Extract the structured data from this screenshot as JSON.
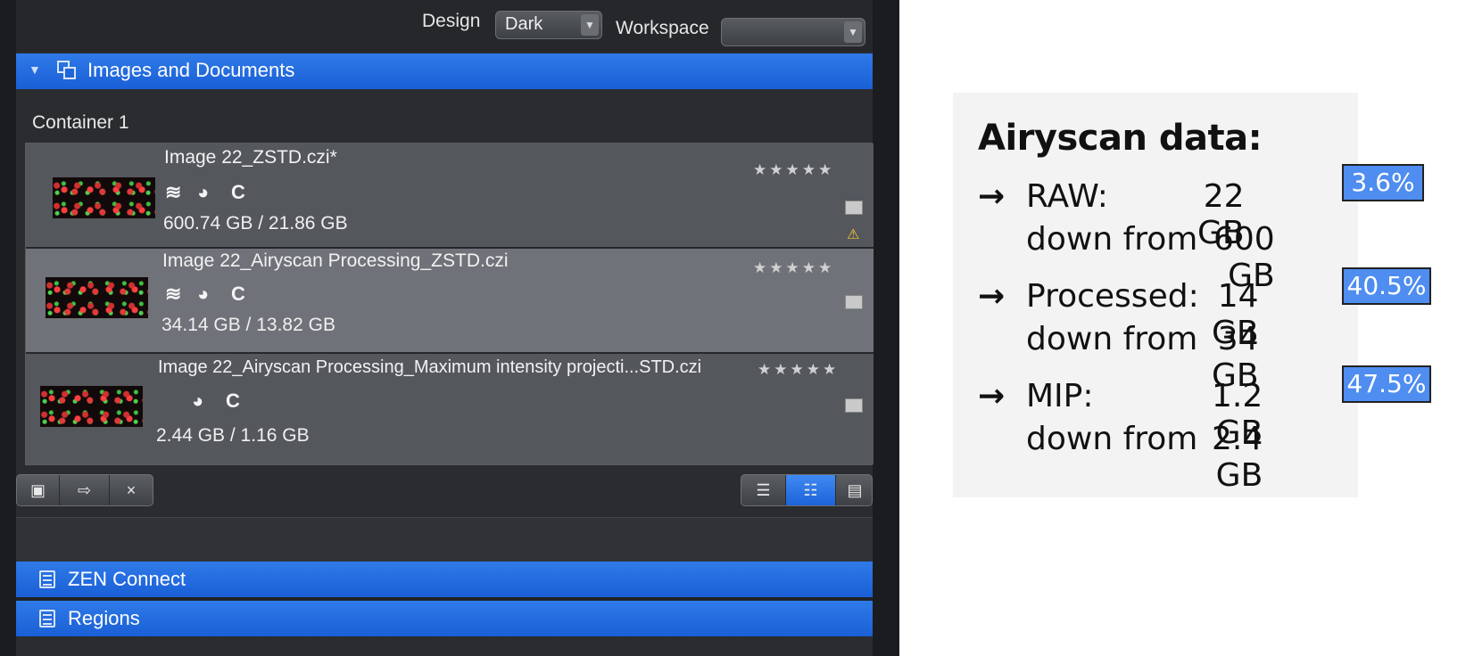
{
  "app": {
    "topbar": {
      "design_label": "Design",
      "design_value": "Dark",
      "workspace_label": "Workspace",
      "workspace_value": ""
    },
    "images_panel": {
      "title": "Images and Documents",
      "container_title": "Container 1",
      "items": [
        {
          "name": "Image 22_ZSTD.czi*",
          "size": "600.74 GB / 21.86 GB",
          "rating": "★★★★★",
          "icons": [
            "stack-icon",
            "clock-icon",
            "c-icon"
          ],
          "selected": false
        },
        {
          "name": "Image 22_Airyscan Processing_ZSTD.czi",
          "size": "34.14 GB / 13.82 GB",
          "rating": "★★★★★",
          "icons": [
            "stack-icon",
            "clock-icon",
            "c-icon"
          ],
          "selected": true
        },
        {
          "name": "Image 22_Airyscan Processing_Maximum intensity projecti...STD.czi",
          "size": "2.44 GB / 1.16 GB",
          "rating": "★★★★★",
          "icons": [
            "clock-icon",
            "c-icon"
          ],
          "selected": false
        }
      ],
      "c_glyph": "C",
      "close_glyph": "×"
    },
    "zen_connect": {
      "title": "ZEN Connect"
    },
    "regions": {
      "title": "Regions"
    }
  },
  "info": {
    "title": "Airyscan data:",
    "arrow": "→",
    "entries": [
      {
        "label": "RAW:",
        "value": "22 GB",
        "sub_label": "down from",
        "sub_value": "600 GB",
        "percent": "3.6%"
      },
      {
        "label": "Processed:",
        "value": "14 GB",
        "sub_label": "down from",
        "sub_value": "34 GB",
        "percent": "40.5%"
      },
      {
        "label": "MIP:",
        "value": "1.2 GB",
        "sub_label": "down from",
        "sub_value": "2.4 GB",
        "percent": "47.5%"
      }
    ]
  },
  "colors": {
    "accent_blue": "#1f66db",
    "percent_badge": "#4f8df0"
  }
}
